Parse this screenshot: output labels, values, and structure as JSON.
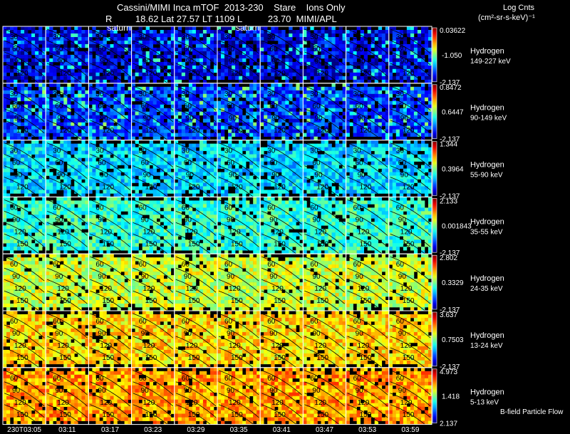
{
  "header": {
    "title_line1": "Cassini/MIMI Inca mTOF  2013-230    Stare    Ions Only",
    "title_line2": "R         18.62 Lat 27.57 LT 1109 L          23.70  MIMI/APL",
    "log_cnts": "Log Cnts",
    "units": "(cm²-sr-s-keV)⁻¹"
  },
  "footer_note": "B-field Particle Flow",
  "chart_data": {
    "type": "heatmap",
    "species": "Hydrogen",
    "time_labels": [
      "230T03:05",
      "03:11",
      "03:17",
      "03:23",
      "03:29",
      "03:35",
      "03:41",
      "03:47",
      "03:53",
      "03:59"
    ],
    "saturn_labels": [
      {
        "frame": 2,
        "text": "saturn"
      },
      {
        "frame": 5,
        "text": "saturn"
      }
    ],
    "contour_labels": [
      "30",
      "60",
      "90",
      "120",
      "150"
    ],
    "rows": [
      {
        "species": "Hydrogen",
        "energy": "149-227 keV",
        "cmax": "0.03622",
        "cmid": "-1.050",
        "cmin": "-2.137",
        "level": 0.1
      },
      {
        "species": "Hydrogen",
        "energy": "90-149 keV",
        "cmax": "0.8472",
        "cmid": "0.6447",
        "cmin": "-2.137",
        "level": 0.18
      },
      {
        "species": "Hydrogen",
        "energy": "55-90 keV",
        "cmax": "1.344",
        "cmid": "0.3964",
        "cmin": "-2.137",
        "level": 0.34
      },
      {
        "species": "Hydrogen",
        "energy": "35-55 keV",
        "cmax": "2.133",
        "cmid": "0.001843",
        "cmin": "-2.137",
        "level": 0.42
      },
      {
        "species": "Hydrogen",
        "energy": "24-35 keV",
        "cmax": "2.802",
        "cmid": "0.3329",
        "cmin": "-2.137",
        "level": 0.58
      },
      {
        "species": "Hydrogen",
        "energy": "13-24 keV",
        "cmax": "3.637",
        "cmid": "0.7503",
        "cmin": "-2.137",
        "level": 0.66
      },
      {
        "species": "Hydrogen",
        "energy": "5-13 keV",
        "cmax": "4.973",
        "cmid": "1.418",
        "cmin": "2.137",
        "level": 0.72
      }
    ]
  }
}
